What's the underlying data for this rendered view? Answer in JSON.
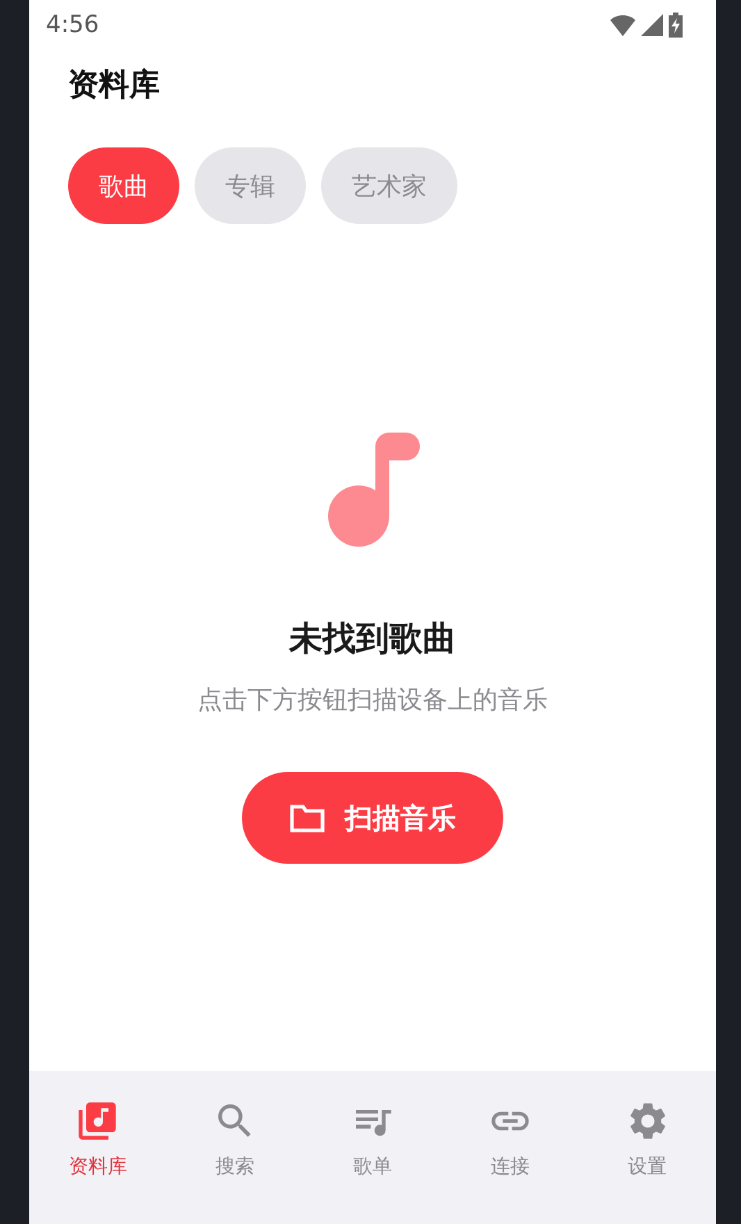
{
  "status_bar": {
    "time": "4:56"
  },
  "header": {
    "title": "资料库"
  },
  "tabs": [
    {
      "label": "歌曲",
      "selected": true
    },
    {
      "label": "专辑",
      "selected": false
    },
    {
      "label": "艺术家",
      "selected": false
    }
  ],
  "empty_state": {
    "title": "未找到歌曲",
    "message": "点击下方按钮扫描设备上的音乐",
    "button": "扫描音乐"
  },
  "bottom_nav": [
    {
      "kind": "library",
      "label": "资料库",
      "selected": true
    },
    {
      "kind": "search",
      "label": "搜索",
      "selected": false
    },
    {
      "kind": "playlist",
      "label": "歌单",
      "selected": false
    },
    {
      "kind": "link",
      "label": "连接",
      "selected": false
    },
    {
      "kind": "settings",
      "label": "设置",
      "selected": false
    }
  ]
}
